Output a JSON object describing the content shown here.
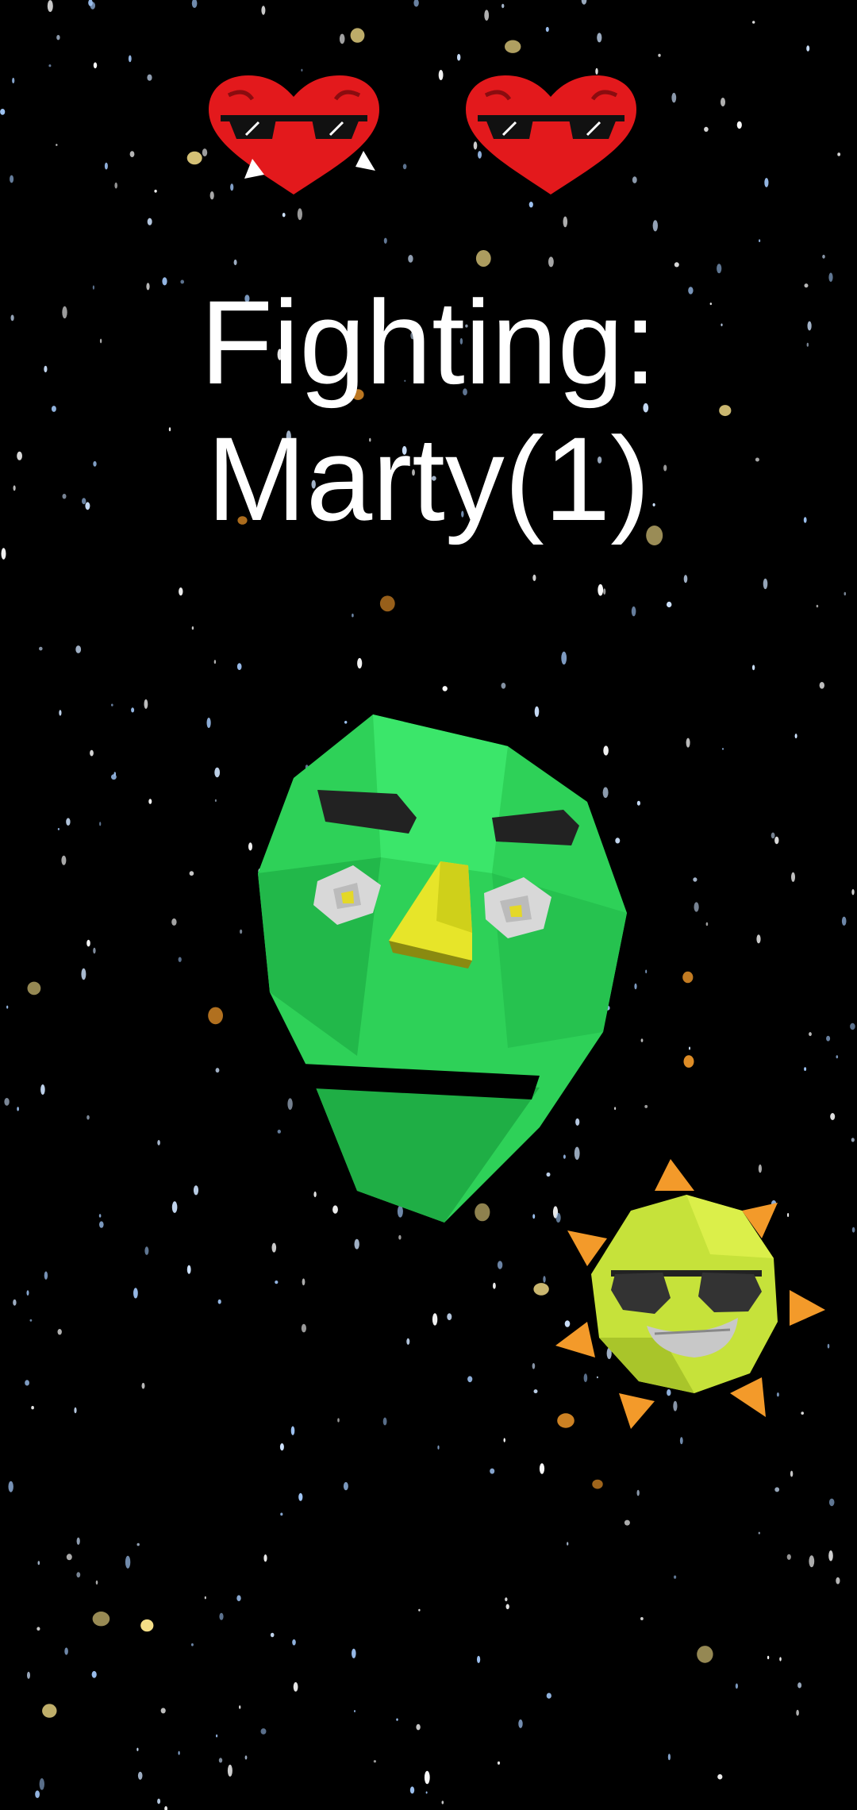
{
  "hud": {
    "lives": [
      {
        "icon": "heart-sunglasses-icon",
        "state": "damaged"
      },
      {
        "icon": "heart-sunglasses-icon",
        "state": "full"
      }
    ],
    "title_line1": "Fighting:",
    "title_line2": "Marty(1)"
  },
  "scene": {
    "background_color": "#000000",
    "enemy": {
      "icon": "green-alien-head-icon",
      "color": "#2ed158"
    },
    "player": {
      "icon": "sun-with-sunglasses-icon",
      "color": "#c6e23a",
      "spike_color": "#f39a2a"
    }
  }
}
